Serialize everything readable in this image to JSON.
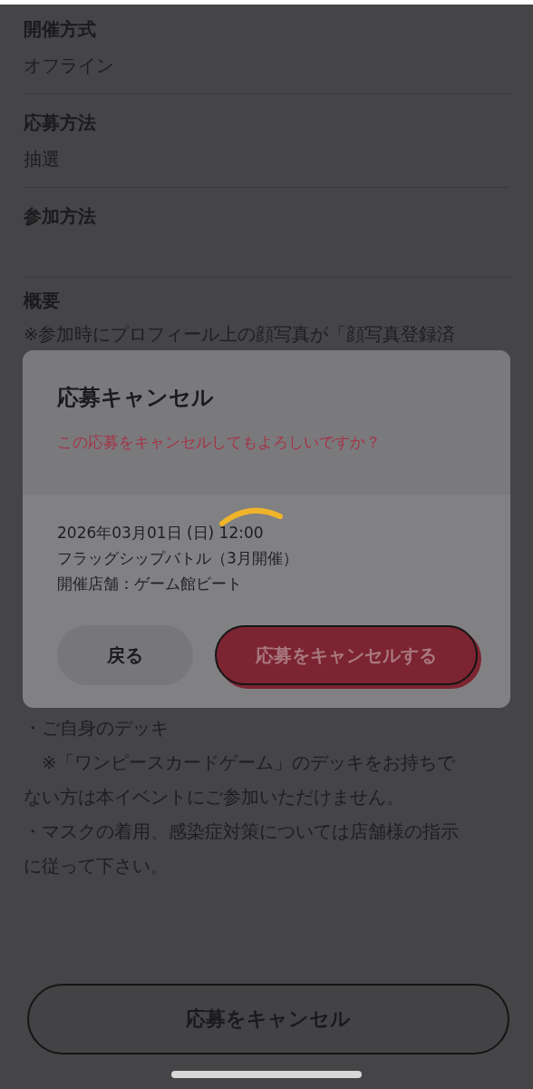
{
  "sections": [
    {
      "label": "開催方式",
      "value": "オフライン"
    },
    {
      "label": "応募方法",
      "value": "抽選"
    },
    {
      "label": "参加方法"
    }
  ],
  "overview": {
    "label": "概要",
    "first_line": "※参加時にプロフィール上の顔写真が「顔写真登録済",
    "lines": [
      "・ご自身のデッキ",
      "　※「ワンピースカードゲーム」のデッキをお持ちで",
      "ない方は本イベントにご参加いただけません。",
      "・マスクの着用、感染症対策については店舗様の指示",
      "に従って下さい。"
    ]
  },
  "modal": {
    "title": "応募キャンセル",
    "message": "この応募をキャンセルしてもよろしいですか？",
    "details": [
      "2026年03月01日 (日) 12:00",
      "フラッグシップバトル（3月開催）",
      "開催店舗：ゲーム館ビート"
    ],
    "loading": true,
    "buttons": [
      {
        "label": "戻る",
        "kind": "secondary"
      },
      {
        "label": "応募をキャンセルする",
        "kind": "danger"
      }
    ]
  },
  "footer_button": "応募をキャンセル"
}
